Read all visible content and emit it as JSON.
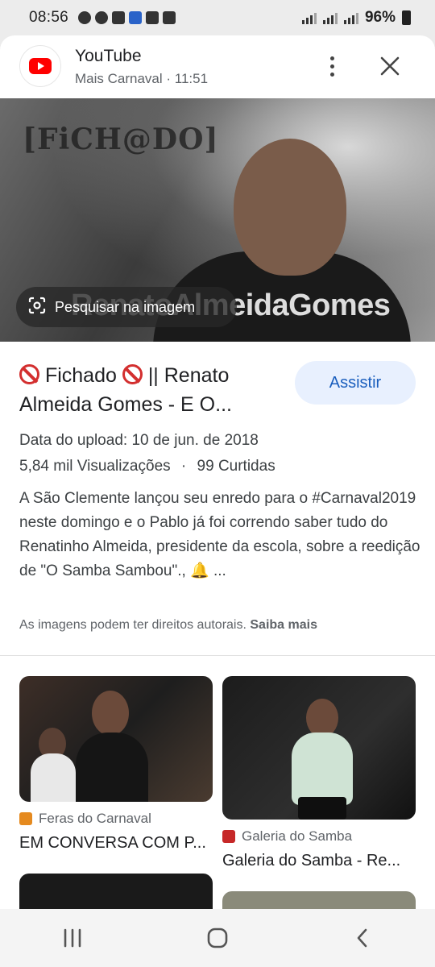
{
  "status_bar": {
    "time": "08:56",
    "battery": "96%"
  },
  "header": {
    "site_name": "YouTube",
    "subtitle": "Mais Carnaval · 11:51"
  },
  "hero": {
    "brand_text": "[FiCH@DO]",
    "caption_text": "RenatoAlmeidaGomes",
    "lens_label": "Pesquisar na imagem"
  },
  "result": {
    "title": "Fichado || Renato Almeida Gomes - E O...",
    "title_part1": "Fichado",
    "title_part2": "|| Renato Almeida Gomes - E O...",
    "watch_label": "Assistir",
    "upload_date": "Data do upload: 10 de jun. de 2018",
    "views": "5,84 mil Visualizações",
    "separator": "·",
    "likes": "99 Curtidas",
    "description": "A São Clemente lançou seu enredo para o #Carnaval2019 neste domingo e o Pablo já foi correndo saber tudo do Renatinho Almeida, presidente da escola, sobre a reedição de \"O Samba Sambou\"., 🔔 ...",
    "copyright_text": "As imagens podem ter direitos autorais.",
    "copyright_link": "Saiba mais"
  },
  "related": [
    {
      "source": "Feras do Carnaval",
      "title": "EM CONVERSA COM P...",
      "source_color": "#e58a1f"
    },
    {
      "source": "Galeria do Samba",
      "title": "Galeria do Samba - Re...",
      "source_color": "#c62828"
    }
  ],
  "icons": [
    "messenger-icon",
    "messenger-icon",
    "printer-icon",
    "shield-icon",
    "youtube-icon",
    "camera-icon",
    "signal-icon",
    "battery-icon",
    "more-vertical-icon",
    "close-icon",
    "lens-icon",
    "no-entry-icon",
    "recents-icon",
    "home-icon",
    "back-icon"
  ]
}
